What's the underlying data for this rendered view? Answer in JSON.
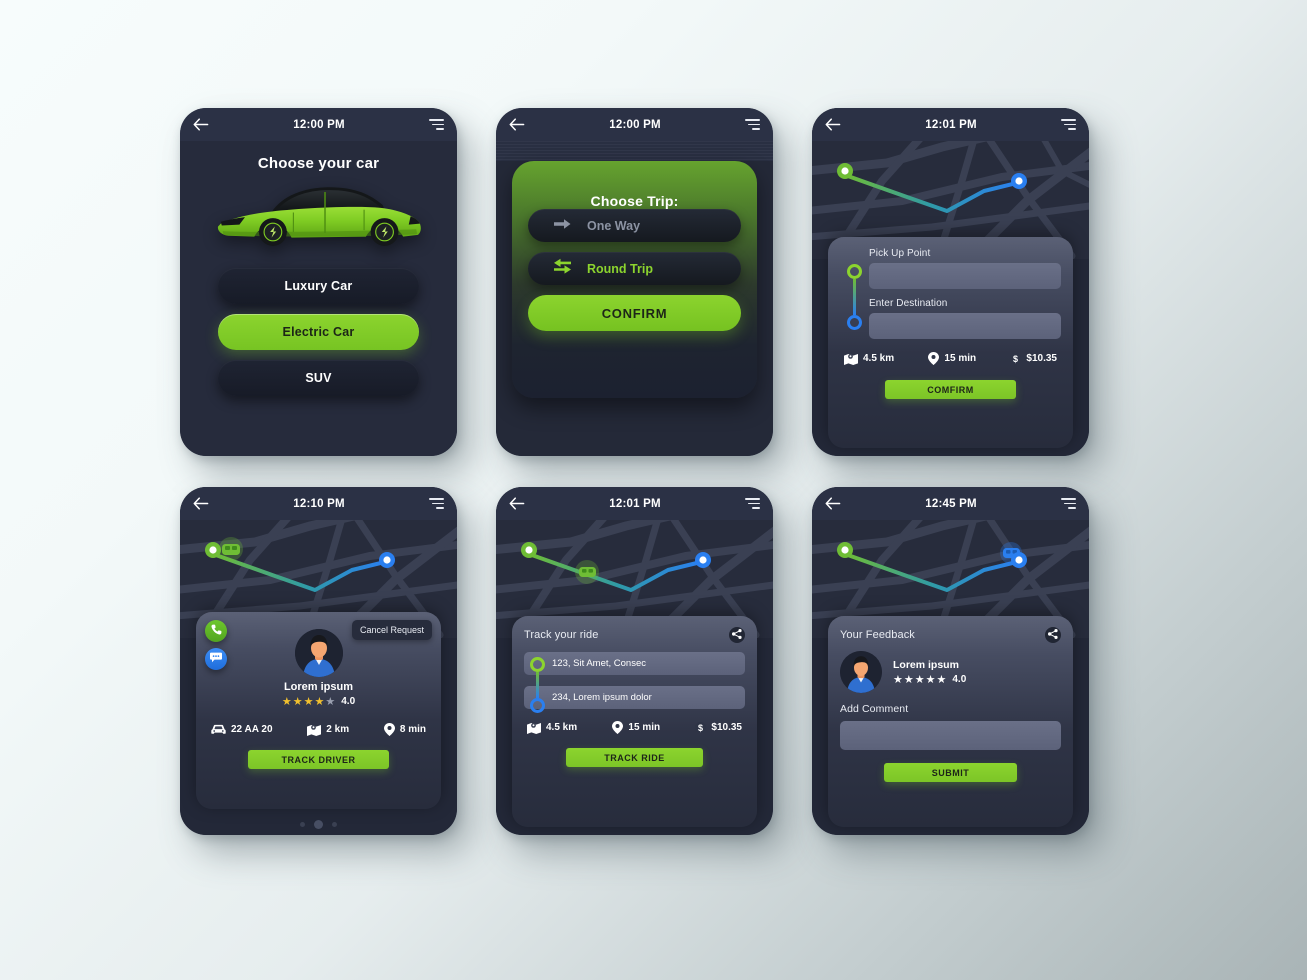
{
  "app": {
    "theme": {
      "accent": "#8cd42e",
      "blue": "#2a7ff0",
      "dark": "#232838",
      "panel": "#474d62",
      "star": "#f2c12e"
    }
  },
  "screens": [
    {
      "id": "choose-car",
      "time": "12:00 PM",
      "title": "Choose your car",
      "options": [
        {
          "label": "Luxury Car",
          "selected": false
        },
        {
          "label": "Electric Car",
          "selected": true
        },
        {
          "label": "SUV",
          "selected": false
        }
      ]
    },
    {
      "id": "choose-trip",
      "time": "12:00 PM",
      "title": "Choose Trip:",
      "options": [
        {
          "label": "One Way",
          "selected": false,
          "icon": "arrow-right-icon"
        },
        {
          "label": "Round Trip",
          "selected": true,
          "icon": "arrows-two-way-icon"
        }
      ],
      "confirm_label": "CONFIRM",
      "pager": {
        "count": 3,
        "active": 1
      }
    },
    {
      "id": "pickup-destination",
      "time": "12:01 PM",
      "pickup_label": "Pick Up Point",
      "pickup_value": "",
      "destination_label": "Enter Destination",
      "destination_value": "",
      "stats": [
        {
          "icon": "map-distance-icon",
          "value": "4.5 km"
        },
        {
          "icon": "location-pin-icon",
          "value": "15 min"
        },
        {
          "icon": "dollar-icon",
          "value": "$10.35"
        }
      ],
      "confirm_label": "COMFIRM"
    },
    {
      "id": "driver-details",
      "time": "12:10 PM",
      "cancel_label": "Cancel Request",
      "driver_name": "Lorem ipsum",
      "rating_value": "4.0",
      "stars_filled": 4,
      "stars_total": 5,
      "stats": [
        {
          "icon": "car-icon",
          "value": "22 AA 20"
        },
        {
          "icon": "map-distance-icon",
          "value": "2 km"
        },
        {
          "icon": "location-pin-icon",
          "value": "8 min"
        }
      ],
      "action_label": "TRACK DRIVER",
      "pager": {
        "count": 3,
        "active": 1
      }
    },
    {
      "id": "track-ride",
      "time": "12:01 PM",
      "title": "Track your ride",
      "addresses": [
        {
          "text": "123, Sit Amet, Consec",
          "marker": "green"
        },
        {
          "text": "234, Lorem ipsum dolor",
          "marker": "blue"
        }
      ],
      "stats": [
        {
          "icon": "map-distance-icon",
          "value": "4.5 km"
        },
        {
          "icon": "location-pin-icon",
          "value": "15 min"
        },
        {
          "icon": "dollar-icon",
          "value": "$10.35"
        }
      ],
      "action_label": "TRACK RIDE"
    },
    {
      "id": "feedback",
      "time": "12:45 PM",
      "title": "Your Feedback",
      "driver_name": "Lorem ipsum",
      "rating_value": "4.0",
      "stars_total": 5,
      "comment_label": "Add Comment",
      "comment_value": "",
      "action_label": "SUBMIT"
    }
  ]
}
